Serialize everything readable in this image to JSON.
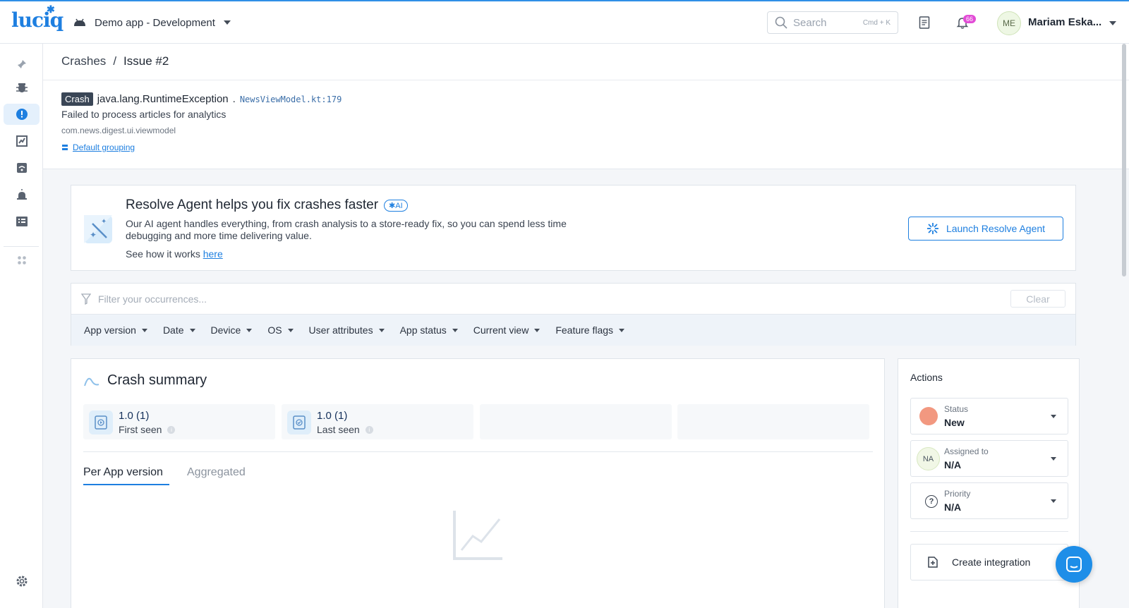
{
  "brand": {
    "logo_text": "luciq"
  },
  "topbar": {
    "app_name": "Demo app - Development",
    "search_placeholder": "Search",
    "search_shortcut": "Cmd + K",
    "notification_count": "66",
    "user_initials": "ME",
    "user_name": "Mariam Eska..."
  },
  "sidebar": {
    "items": [
      {
        "icon": "pin-icon"
      },
      {
        "icon": "bug-icon"
      },
      {
        "icon": "crash-icon",
        "active": true
      },
      {
        "icon": "performance-icon"
      },
      {
        "icon": "network-icon"
      },
      {
        "icon": "alert-icon"
      },
      {
        "icon": "list-icon"
      },
      {
        "icon": "apps-grid-icon"
      },
      {
        "icon": "settings-icon"
      }
    ]
  },
  "breadcrumb": {
    "parent": "Crashes",
    "separator": "/",
    "current": "Issue #2"
  },
  "issue": {
    "tag": "Crash",
    "exception": "java.lang.RuntimeException",
    "separator": ".",
    "location": "NewsViewModel.kt:179",
    "message": "Failed to process articles for analytics",
    "package": "com.news.digest.ui.viewmodel",
    "grouping_link": "Default grouping"
  },
  "agent_banner": {
    "title": "Resolve Agent helps you fix crashes faster",
    "ai_chip": "AI",
    "description": "Our AI agent handles everything, from crash analysis to a store-ready fix, so you can spend less time debugging and more time delivering value.",
    "see_how_prefix": "See how it works",
    "see_how_link": "here",
    "launch_button": "Launch Resolve Agent"
  },
  "filter": {
    "placeholder": "Filter your occurrences...",
    "clear_label": "Clear",
    "chips": [
      "App version",
      "Date",
      "Device",
      "OS",
      "User attributes",
      "App status",
      "Current view",
      "Feature flags"
    ]
  },
  "summary": {
    "title": "Crash summary",
    "stats": [
      {
        "value": "1.0 (1)",
        "label": "First seen"
      },
      {
        "value": "1.0 (1)",
        "label": "Last seen"
      }
    ],
    "tabs": [
      "Per App version",
      "Aggregated"
    ],
    "active_tab": "Per App version"
  },
  "actions": {
    "title": "Actions",
    "status": {
      "label": "Status",
      "value": "New",
      "color": "#f29880"
    },
    "assigned": {
      "label": "Assigned to",
      "initials": "NA",
      "value": "N/A"
    },
    "priority": {
      "label": "Priority",
      "icon_text": "?",
      "value": "N/A"
    },
    "integration_label": "Create integration"
  },
  "colors": {
    "accent": "#1e7fe0",
    "crash_tag": "#3a4656",
    "status_new": "#f29880",
    "notif_badge": "#e24bd6"
  }
}
